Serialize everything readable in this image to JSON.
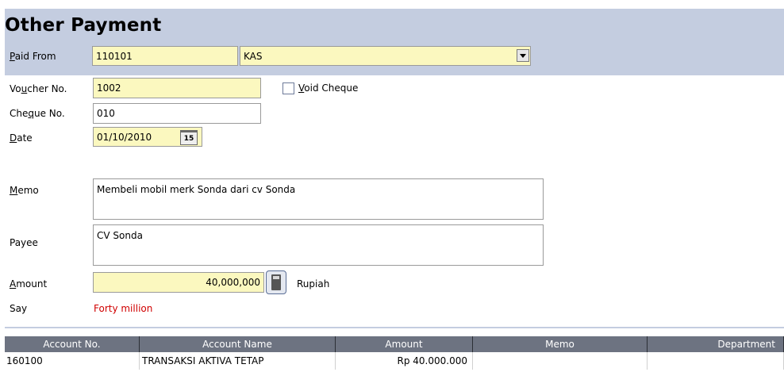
{
  "form": {
    "title": "Other Payment",
    "paid_from": {
      "label_u": "P",
      "label_rest": "aid From",
      "account_code": "110101",
      "account_name": "KAS"
    },
    "voucher": {
      "label_pre": "Vo",
      "label_u": "u",
      "label_post": "cher No.",
      "value": "1002"
    },
    "void_cheque": {
      "label_u": "V",
      "label_rest": "oid Cheque",
      "checked": false
    },
    "cheque": {
      "label_pre": "Che",
      "label_u": "q",
      "label_post": "ue No.",
      "value": "010"
    },
    "date": {
      "label_u": "D",
      "label_rest": "ate",
      "value": "01/10/2010",
      "calendar_text": "15"
    },
    "memo": {
      "label_u": "M",
      "label_rest": "emo",
      "value": "Membeli mobil merk Sonda dari cv Sonda"
    },
    "payee": {
      "label": "Payee",
      "value": "CV Sonda"
    },
    "amount": {
      "label_u": "A",
      "label_rest": "mount",
      "value": "40,000,000",
      "currency": "Rupiah"
    },
    "say": {
      "label": "Say",
      "value": "Forty million"
    }
  },
  "table": {
    "columns": [
      "Account No.",
      "Account Name",
      "Amount",
      "Memo",
      "Department"
    ],
    "rows": [
      {
        "account_no": "160100",
        "account_name": "TRANSAKSI AKTIVA TETAP",
        "amount": "Rp 40.000.000",
        "memo": "",
        "department": ""
      }
    ]
  },
  "colors": {
    "header_band": "#c4cde0",
    "input_yellow": "#fbf8bf",
    "grid_header": "#6d7381",
    "say_text": "#d00000"
  }
}
